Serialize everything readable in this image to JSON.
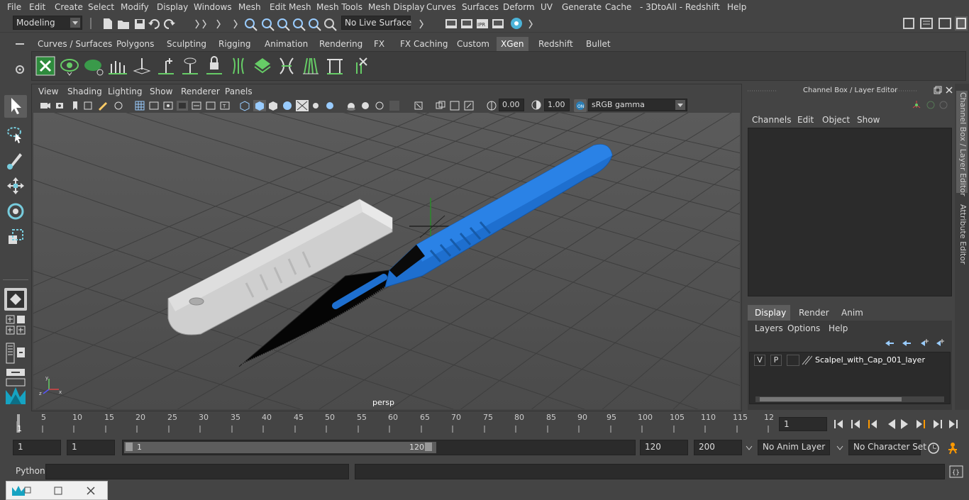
{
  "menubar": {
    "items": [
      "File",
      "Edit",
      "Create",
      "Select",
      "Modify",
      "Display",
      "Windows",
      "Mesh",
      "Edit Mesh",
      "Mesh Tools",
      "Mesh Display",
      "Curves",
      "Surfaces",
      "Deform",
      "UV",
      "Generate",
      "Cache",
      "- 3DtoAll -",
      "Redshift",
      "Help"
    ]
  },
  "statusline": {
    "mode": "Modeling",
    "live_surface": "No Live Surface"
  },
  "shelf": {
    "tabs": [
      "Curves / Surfaces",
      "Polygons",
      "Sculpting",
      "Rigging",
      "Animation",
      "Rendering",
      "FX",
      "FX Caching",
      "Custom",
      "XGen",
      "Redshift",
      "Bullet"
    ],
    "active_tab": "XGen"
  },
  "viewport": {
    "menu": [
      "View",
      "Shading",
      "Lighting",
      "Show",
      "Renderer",
      "Panels"
    ],
    "exposure": "0.00",
    "gamma": "1.00",
    "colorspace": "sRGB gamma",
    "camera_label": "persp"
  },
  "channelbox": {
    "title": "Channel Box / Layer Editor",
    "menu": [
      "Channels",
      "Edit",
      "Object",
      "Show"
    ],
    "layer_tabs": [
      "Display",
      "Render",
      "Anim"
    ],
    "active_layer_tab": "Display",
    "layer_menu": [
      "Layers",
      "Options",
      "Help"
    ],
    "layer": {
      "v": "V",
      "p": "P",
      "name": "Scalpel_with_Cap_001_layer"
    }
  },
  "sidetabs": [
    "Channel Box / Layer Editor",
    "Attribute Editor"
  ],
  "timeline": {
    "ticks": [
      "5",
      "10",
      "15",
      "20",
      "25",
      "30",
      "35",
      "40",
      "45",
      "50",
      "55",
      "60",
      "65",
      "70",
      "75",
      "80",
      "85",
      "90",
      "95",
      "100",
      "105",
      "110",
      "115",
      "12"
    ],
    "start_marker": "1",
    "current_frame": "1"
  },
  "range": {
    "start": "1",
    "playback_start": "1",
    "slider_start": "1",
    "slider_end": "120",
    "playback_end": "120",
    "end": "200",
    "anim_layer": "No Anim Layer",
    "character_set": "No Character Set"
  },
  "cmdline": {
    "language": "Python"
  },
  "colors": {
    "accent_blue": "#1e6fcf",
    "active_tab": "#5d5d5d",
    "panel": "#444444"
  }
}
